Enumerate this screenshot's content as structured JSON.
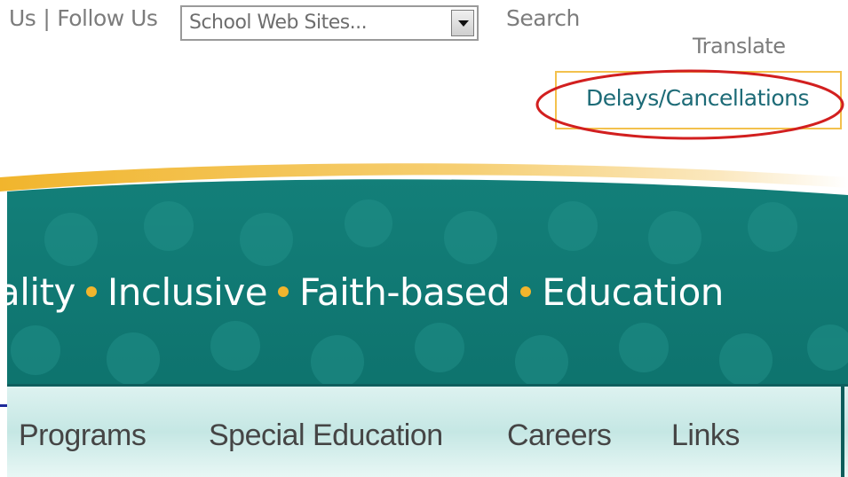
{
  "header": {
    "utility_links": [
      "Us",
      "Follow Us"
    ],
    "utility_separator": "|",
    "school_select": {
      "value": "School Web Sites..."
    },
    "search_label": "Search",
    "translate_label": "Translate",
    "delays_label": "Delays/Cancellations"
  },
  "banner": {
    "tagline_words": [
      "ality",
      "Inclusive",
      "Faith-based",
      "Education"
    ]
  },
  "nav": {
    "items": [
      "Programs",
      "Special Education",
      "Careers",
      "Links"
    ]
  },
  "colors": {
    "teal": "#0f7a74",
    "accent_gold": "#f1b52d",
    "highlight_red": "#d21f1f",
    "link_teal": "#1d6b77"
  }
}
